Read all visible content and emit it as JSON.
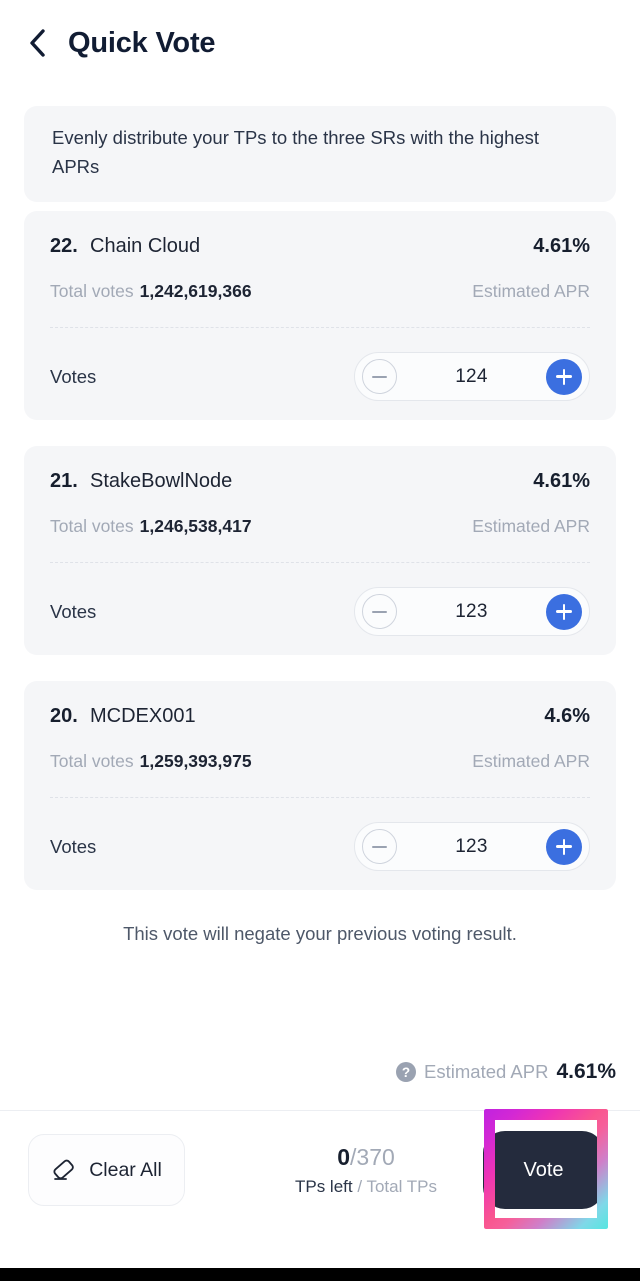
{
  "header": {
    "back_icon": "chevron-left-icon",
    "title": "Quick Vote"
  },
  "banner": {
    "text": "Evenly distribute your TPs to the three SRs with the highest APRs"
  },
  "labels": {
    "total_votes": "Total votes",
    "estimated_apr": "Estimated APR",
    "votes": "Votes",
    "minus_icon": "minus-circle-icon",
    "plus_icon": "plus-circle-icon"
  },
  "cards": [
    {
      "rank": "22.",
      "name": "Chain Cloud",
      "apr": "4.61%",
      "total_votes": "1,242,619,366",
      "vote_count": "124"
    },
    {
      "rank": "21.",
      "name": "StakeBowlNode",
      "apr": "4.61%",
      "total_votes": "1,246,538,417",
      "vote_count": "123"
    },
    {
      "rank": "20.",
      "name": "MCDEX001",
      "apr": "4.6%",
      "total_votes": "1,259,393,975",
      "vote_count": "123"
    }
  ],
  "negate_note": "This vote will negate your previous voting result.",
  "apr_summary": {
    "help_icon": "question-mark-circle-icon",
    "help_glyph": "?",
    "label": "Estimated APR",
    "value": "4.61%"
  },
  "bottom_bar": {
    "clear_all_label": "Clear All",
    "clear_all_icon": "eraser-icon",
    "tps_left": "0",
    "tps_total": "/370",
    "tps_caption_left": "TPs left",
    "tps_caption_right": " / Total TPs",
    "vote_label": "Vote"
  },
  "colors": {
    "accent_blue": "#3b6fe0",
    "card_bg": "#f5f6f8",
    "text_dark": "#1d2433",
    "text_muted": "#a2a9b6",
    "vote_btn_bg": "#242b3d",
    "highlight_magenta": "#c022e0",
    "highlight_pink": "#f9568f",
    "highlight_cyan": "#55e6e0"
  }
}
